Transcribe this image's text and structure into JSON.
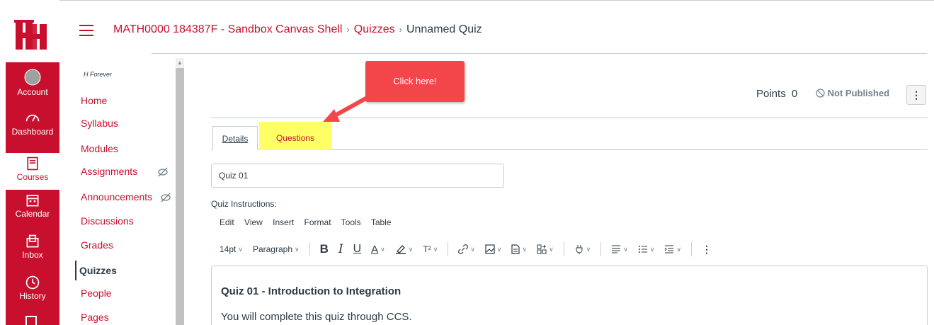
{
  "breadcrumb": {
    "course": "MATH0000 184387F - Sandbox Canvas Shell",
    "section": "Quizzes",
    "current": "Unnamed Quiz",
    "separator": "›"
  },
  "global_nav": {
    "items": [
      {
        "label": "Account",
        "icon": "account-icon"
      },
      {
        "label": "Dashboard",
        "icon": "dashboard-icon"
      },
      {
        "label": "Courses",
        "icon": "courses-icon"
      },
      {
        "label": "Calendar",
        "icon": "calendar-icon"
      },
      {
        "label": "Inbox",
        "icon": "inbox-icon"
      },
      {
        "label": "History",
        "icon": "history-icon"
      }
    ],
    "brand_color": "#c8102e"
  },
  "course_nav": {
    "term": "H Forever",
    "items": [
      {
        "label": "Home"
      },
      {
        "label": "Syllabus"
      },
      {
        "label": "Modules"
      },
      {
        "label": "Assignments"
      },
      {
        "label": "Announcements"
      },
      {
        "label": "Discussions"
      },
      {
        "label": "Grades"
      },
      {
        "label": "Quizzes"
      },
      {
        "label": "People"
      },
      {
        "label": "Pages"
      }
    ]
  },
  "header": {
    "points_label": "Points",
    "points_value": "0",
    "publish_status": "Not Published",
    "more": "⋮"
  },
  "callout": {
    "text": "Click here!"
  },
  "tabs": [
    {
      "label": "Details"
    },
    {
      "label": "Questions"
    }
  ],
  "quiz": {
    "title_value": "Quiz 01",
    "instructions_label": "Quiz Instructions:"
  },
  "editor": {
    "menus": [
      "Edit",
      "View",
      "Insert",
      "Format",
      "Tools",
      "Table"
    ],
    "font_size": "14pt",
    "block_format": "Paragraph",
    "bold": "B",
    "italic": "I",
    "underline": "U",
    "text_color": "A",
    "superscript": "T²",
    "more": "⋮",
    "content_heading": "Quiz 01 - Introduction to Integration",
    "content_paragraph": "You will complete this quiz through CCS."
  }
}
